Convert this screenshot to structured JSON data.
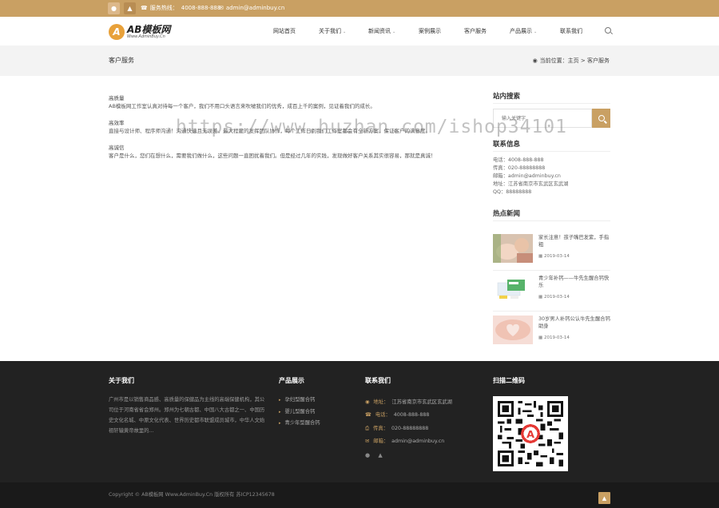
{
  "topbar": {
    "phone_label": "服务热线：",
    "phone": "4008-888-888",
    "email": "admin@adminbuy.cn"
  },
  "brand": {
    "name": "AB模板网",
    "tagline": "Www.AdminBuy.Cn",
    "accent": "#c9a063"
  },
  "nav": [
    {
      "label": "网站首页",
      "dropdown": false
    },
    {
      "label": "关于我们",
      "dropdown": true
    },
    {
      "label": "新闻资讯",
      "dropdown": true
    },
    {
      "label": "案例展示",
      "dropdown": false
    },
    {
      "label": "客户服务",
      "dropdown": false
    },
    {
      "label": "产品展示",
      "dropdown": true
    },
    {
      "label": "联系我们",
      "dropdown": false
    }
  ],
  "page": {
    "title": "客户服务",
    "breadcrumb_prefix": "当前位置：",
    "breadcrumb": "主页 > 客户服务"
  },
  "content": [
    {
      "heading": "高质量",
      "text": "AB模板网工作室认真对待每一个客户，我们不用口头语言来吹嘘我们的优秀，成百上千的案例，见证着我们的成长。"
    },
    {
      "heading": "高效率",
      "text": "直接与设计师、程序师沟通！沟通快速且无误差，最大程度的发挥团队协作，每个工作日到我们工作室都会有全新方案，保证客户的满意度。"
    },
    {
      "heading": "高诚信",
      "text": "客户是什么，您们在想什么，需要我们做什么，这些问题一直困扰着我们。但是经过几年的实践，发现做好客户关系其实很容易，那就是真诚！"
    }
  ],
  "sidebar": {
    "search_title": "站内搜索",
    "search_placeholder": "输入关键字",
    "contact_title": "联系信息",
    "contact": [
      "电话：4008-888-888",
      "传真：020-88888888",
      "邮箱：admin@adminbuy.cn",
      "地址：江苏省南京市玄武区玄武湖",
      "QQ：88888888"
    ],
    "news_title": "热点新闻",
    "news": [
      {
        "title": "家长注意！孩子嘴巴发紫，手指粗",
        "date": "2019-03-14",
        "icon": "baby-photo"
      },
      {
        "title": "青少年补钙——牛先生醒合钙快乐",
        "date": "2019-03-14",
        "icon": "product-box"
      },
      {
        "title": "30岁男人补钙公认牛先生醒合钙助身",
        "date": "2019-03-14",
        "icon": "heart-hands"
      }
    ]
  },
  "footer": {
    "about_title": "关于我们",
    "about_text": "广州市是以销售商品感、高质量的保健品为主线的高端保健机构，其公司位于河南省省会郑州。郑州为七朝古都、中国八大古都之一、中国历史文化名城、中原文化代表、世界历史都市联盟成员城市，中华人文始祖轩辕黄帝故里的...",
    "products_title": "产品展示",
    "products": [
      "孕妇型醒合钙",
      "婴儿型醒合钙",
      "青少年型醒合钙"
    ],
    "contact_title": "联系我们",
    "contact": [
      {
        "label": "地址：",
        "value": "江苏省南京市玄武区玄武湖"
      },
      {
        "label": "电话：",
        "value": "4008-888-888"
      },
      {
        "label": "传真：",
        "value": "020-88888888"
      },
      {
        "label": "邮箱：",
        "value": "admin@adminbuy.cn"
      }
    ],
    "qr_title": "扫描二维码",
    "copyright": "Copyright © AB模板网 Www.AdminBuy.Cn 版权所有   苏ICP12345678"
  },
  "watermark": "https://www.huzhan.com/ishop34101"
}
